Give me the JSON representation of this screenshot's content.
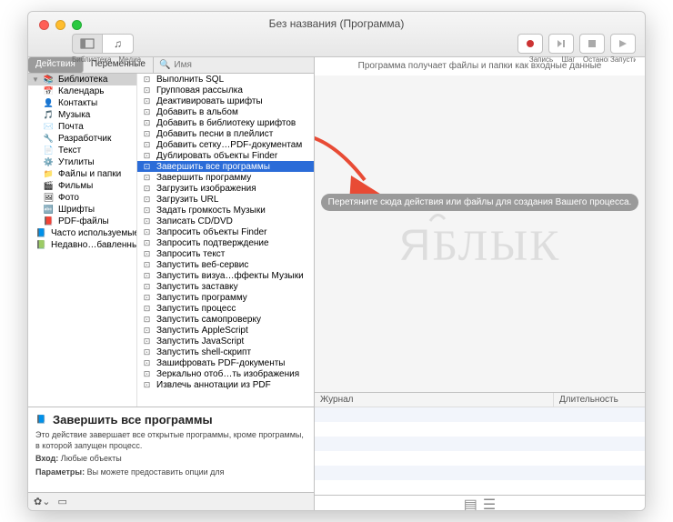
{
  "window": {
    "title": "Без названия (Программа)"
  },
  "toolbar_left": {
    "library_label": "Библиотека",
    "media_label": "Медиа"
  },
  "toolbar_right": {
    "record": "Запись",
    "step": "Шаг",
    "stop": "Остановить",
    "run": "Запустить"
  },
  "tabs": {
    "actions": "Действия",
    "variables": "Переменные"
  },
  "search": {
    "placeholder": "Имя"
  },
  "categories": [
    "Библиотека",
    "Календарь",
    "Контакты",
    "Музыка",
    "Почта",
    "Разработчик",
    "Текст",
    "Утилиты",
    "Файлы и папки",
    "Фильмы",
    "Фото",
    "Шрифты",
    "PDF-файлы",
    "Часто используемые",
    "Недавно…бавленные"
  ],
  "category_icons": [
    "📚",
    "📅",
    "👤",
    "🎵",
    "✉️",
    "🔧",
    "📄",
    "⚙️",
    "📁",
    "🎬",
    "🖼",
    "🔤",
    "📕",
    "📘",
    "📗"
  ],
  "actions": [
    "Выполнить SQL",
    "Групповая рассылка",
    "Деактивировать шрифты",
    "Добавить в альбом",
    "Добавить в библиотеку шрифтов",
    "Добавить песни в плейлист",
    "Добавить сетку…PDF-документам",
    "Дублировать объекты Finder",
    "Завершить все программы",
    "Завершить программу",
    "Загрузить изображения",
    "Загрузить URL",
    "Задать громкость Музыки",
    "Записать CD/DVD",
    "Запросить объекты Finder",
    "Запросить подтверждение",
    "Запросить текст",
    "Запустить веб-сервис",
    "Запустить визуа…ффекты Музыки",
    "Запустить заставку",
    "Запустить программу",
    "Запустить процесс",
    "Запустить самопроверку",
    "Запустить AppleScript",
    "Запустить JavaScript",
    "Запустить shell-скрипт",
    "Зашифровать PDF-документы",
    "Зеркально отоб…ть изображения",
    "Извлечь аннотации из PDF"
  ],
  "selected_action_index": 8,
  "info": {
    "title": "Завершить все программы",
    "desc": "Это действие завершает все открытые программы, кроме программы, в которой запущен процесс.",
    "input_label": "Вход:",
    "input_value": "Любые объекты",
    "params_label": "Параметры:",
    "params_value": "Вы можете предоставить опции для"
  },
  "workflow": {
    "header": "Программа получает файлы и папки как входные данные",
    "hint": "Перетяните сюда действия или файлы для создания Вашего процесса."
  },
  "log": {
    "col_journal": "Журнал",
    "col_duration": "Длительность"
  },
  "watermark": "ЯБЛЫК"
}
